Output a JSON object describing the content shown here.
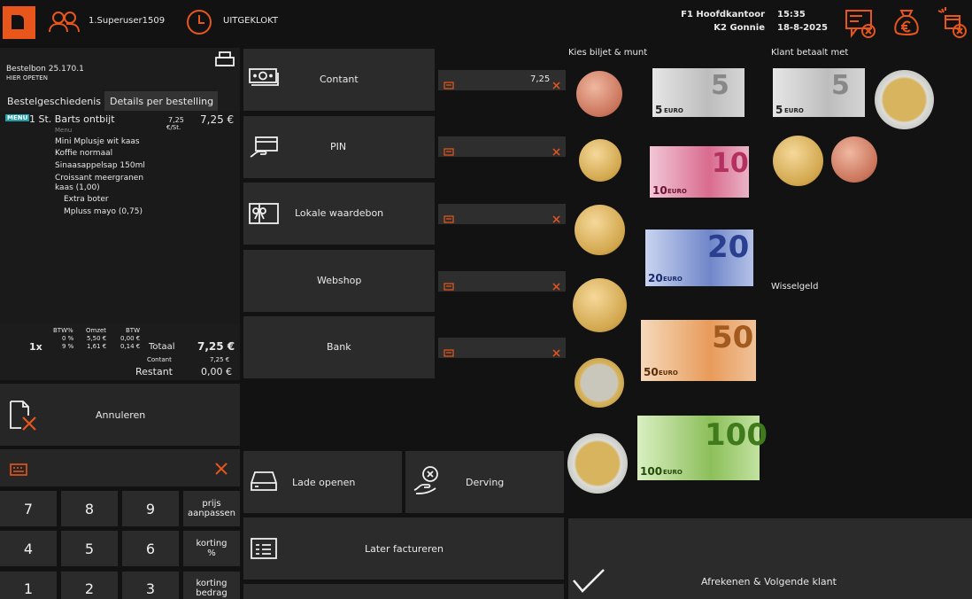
{
  "topbar": {
    "user": "1.Superuser1509",
    "clock_status": "UITGEKLOKT",
    "location": "F1 Hoofdkantoor",
    "time": "15:35",
    "register": "K2 Gonnie",
    "date": "18-8-2025"
  },
  "order": {
    "title": "Bestelbon 25.170.1",
    "subtitle": "HIER OPETEN",
    "tab_history": "Bestelgeschiedenis",
    "tab_details": "Details per bestelling",
    "item": {
      "badge": "MENU",
      "name": "1 St. Barts ontbijt",
      "sub": "Menu",
      "unit_price": "7,25",
      "unit_label": "€/St.",
      "price": "7,25 €",
      "components": [
        "Mini Mplusje wit kaas",
        "Koffie normaal",
        "Sinaasappelsap 150ml",
        "Croissant meergranen kaas (1,00)"
      ],
      "extras": [
        "Extra boter",
        "Mpluss mayo (0,75)"
      ]
    },
    "summary": {
      "quantity": "1x",
      "col_btw_pct": "BTW%",
      "col_omzet": "Omzet",
      "col_btw": "BTW",
      "rows": [
        {
          "pct": "0 %",
          "omzet": "5,50 €",
          "btw": "0,00 €"
        },
        {
          "pct": "9 %",
          "omzet": "1,61 €",
          "btw": "0,14 €"
        }
      ],
      "total_label": "Totaal",
      "total_value": "7,25 €",
      "contant_label": "Contant",
      "contant_value": "7,25 €",
      "restant_label": "Restant",
      "restant_value": "0,00 €"
    }
  },
  "cancel_label": "Annuleren",
  "keypad": {
    "rows": [
      [
        "7",
        "8",
        "9",
        "prijs aanpassen"
      ],
      [
        "4",
        "5",
        "6",
        "korting %"
      ],
      [
        "1",
        "2",
        "3",
        "korting bedrag"
      ]
    ]
  },
  "payment_methods": [
    {
      "label": "Contant",
      "value": "7,25"
    },
    {
      "label": "PIN",
      "value": ""
    },
    {
      "label": "Lokale waardebon",
      "value": ""
    },
    {
      "label": "Webshop",
      "value": ""
    },
    {
      "label": "Bank",
      "value": ""
    }
  ],
  "actions": {
    "drawer": "Lade openen",
    "waste": "Derving",
    "invoice": "Later factureren",
    "checkout": "Afrekenen & Volgende klant"
  },
  "cash": {
    "choose_header": "Kies biljet & munt",
    "paid_header": "Klant betaalt met",
    "change_header": "Wisselgeld",
    "coins": [
      "5 cent",
      "10 cent",
      "20 cent",
      "50 cent",
      "1 euro",
      "2 euro"
    ],
    "notes": [
      "5",
      "10",
      "20",
      "50",
      "100"
    ],
    "note_currency": "EURO",
    "paid_coins": [
      "2 euro",
      "20 cent",
      "5 cent"
    ],
    "paid_notes": [
      "5"
    ]
  },
  "colors": {
    "accent": "#e8561b",
    "panel": "#262626",
    "background": "#121212",
    "note5": "#c9c9c9",
    "note10": "#d96b8f",
    "note20": "#6f86c9",
    "note50": "#e89b5a",
    "note100": "#8cbf5a"
  }
}
